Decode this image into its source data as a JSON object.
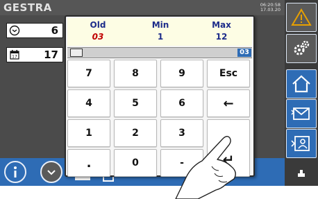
{
  "header": {
    "brand": "GESTRA",
    "time": "06:20:58",
    "date": "17.03.20"
  },
  "rows": [
    {
      "icon": "clock-icon",
      "value": "6"
    },
    {
      "icon": "calendar-icon",
      "value": "17"
    }
  ],
  "dialog": {
    "old_label": "Old",
    "old_value": "03",
    "min_label": "Min",
    "min_value": "1",
    "max_label": "Max",
    "max_value": "12",
    "current_value": "03",
    "keys": [
      "7",
      "8",
      "9",
      "Esc",
      "4",
      "5",
      "6",
      "←",
      "1",
      "2",
      "3",
      "",
      "",
      ""
    ]
  },
  "keypad": {
    "k7": "7",
    "k8": "8",
    "k9": "9",
    "esc": "Esc",
    "k4": "4",
    "k5": "5",
    "k6": "6",
    "back": "←",
    "k1": "1",
    "k2": "2",
    "k3": "3",
    "dot": ".",
    "k0": "0",
    "minus": "-",
    "enter": "↵"
  },
  "colors": {
    "accent": "#2e6cb5",
    "old_value": "#c00000",
    "label": "#1d2c8a",
    "warning": "#e0a000"
  }
}
